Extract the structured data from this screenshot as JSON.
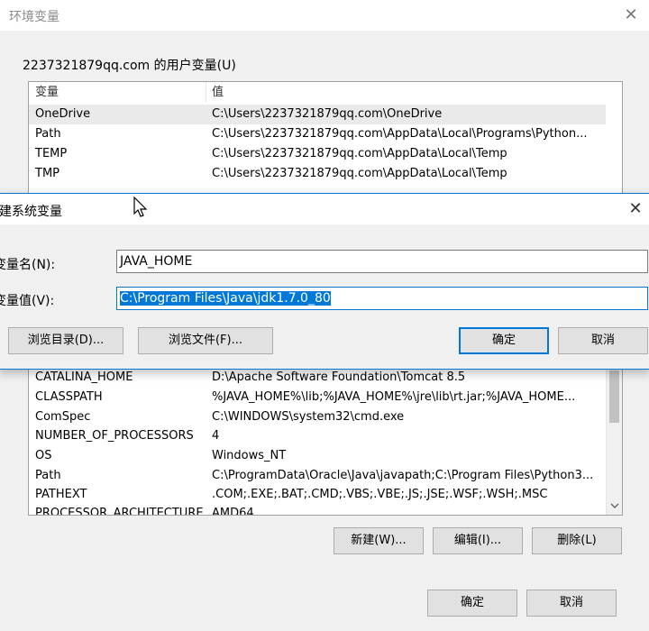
{
  "background_window": {
    "title": "环境变量",
    "close_glyph": "✕",
    "user_group_label": "2237321879qq.com 的用户变量(U)",
    "columns": [
      "变量",
      "值"
    ],
    "user_vars": [
      {
        "name": "OneDrive",
        "value": "C:\\Users\\2237321879qq.com\\OneDrive"
      },
      {
        "name": "Path",
        "value": "C:\\Users\\2237321879qq.com\\AppData\\Local\\Programs\\Python..."
      },
      {
        "name": "TEMP",
        "value": "C:\\Users\\2237321879qq.com\\AppData\\Local\\Temp"
      },
      {
        "name": "TMP",
        "value": "C:\\Users\\2237321879qq.com\\AppData\\Local\\Temp"
      }
    ],
    "system_vars": [
      {
        "name": "CATALINA_HOME",
        "value": "D:\\Apache Software Foundation\\Tomcat 8.5"
      },
      {
        "name": "CLASSPATH",
        "value": "%JAVA_HOME%\\lib;%JAVA_HOME%\\jre\\lib\\rt.jar;%JAVA_HOME..."
      },
      {
        "name": "ComSpec",
        "value": "C:\\WINDOWS\\system32\\cmd.exe"
      },
      {
        "name": "NUMBER_OF_PROCESSORS",
        "value": "4"
      },
      {
        "name": "OS",
        "value": "Windows_NT"
      },
      {
        "name": "Path",
        "value": "C:\\ProgramData\\Oracle\\Java\\javapath;C:\\Program Files\\Python3..."
      },
      {
        "name": "PATHEXT",
        "value": ".COM;.EXE;.BAT;.CMD;.VBS;.VBE;.JS;.JSE;.WSF;.WSH;.MSC"
      },
      {
        "name": "PROCESSOR_ARCHITECTURE",
        "value": "AMD64"
      }
    ],
    "system_buttons": {
      "new": "新建(W)...",
      "edit": "编辑(I)...",
      "delete": "删除(L)"
    },
    "footer_buttons": {
      "ok": "确定",
      "cancel": "取消"
    }
  },
  "dialog": {
    "title": "建系统变量",
    "close_glyph": "✕",
    "name_label": "变量名(N):",
    "name_value": "JAVA_HOME",
    "value_label": "变量值(V):",
    "value_value": "C:\\Program Files\\Java\\jdk1.7.0_80",
    "buttons": {
      "browse_dir": "浏览目录(D)...",
      "browse_file": "浏览文件(F)...",
      "ok": "确定",
      "cancel": "取消"
    }
  },
  "colors": {
    "accent": "#0078d7",
    "selection_bg": "#0078d7",
    "row_highlight": "#eaeaea"
  },
  "icons": {
    "cursor": "mouse-pointer-icon",
    "scroll_down": "chevron-down-icon"
  }
}
